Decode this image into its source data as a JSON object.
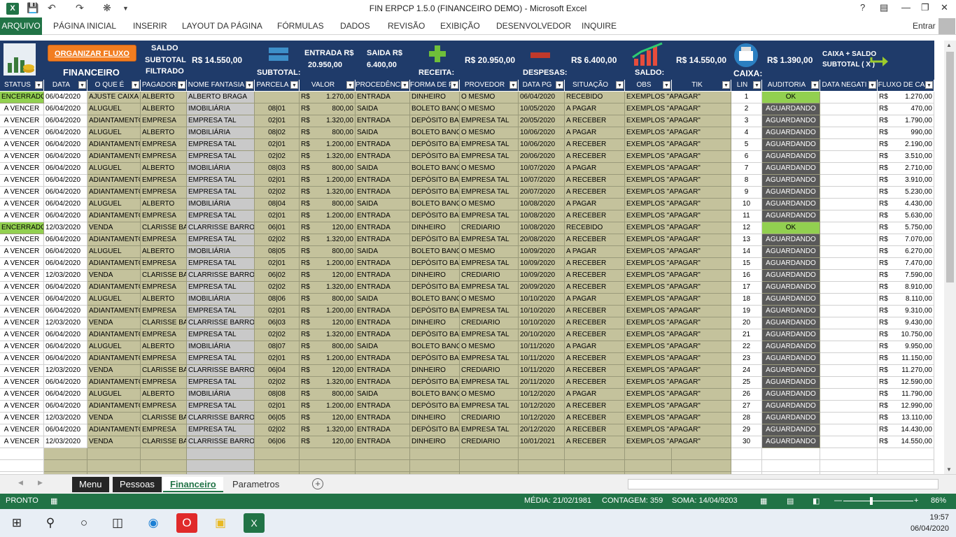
{
  "window": {
    "title": "FIN ERPCP 1.5.0 (FINANCEIRO DEMO) - Microsoft Excel",
    "help": "?",
    "app_icon": "X"
  },
  "ribbon": {
    "file_tab": "ARQUIVO",
    "tabs": [
      "PÁGINA INICIAL",
      "INSERIR",
      "LAYOUT DA PÁGINA",
      "FÓRMULAS",
      "DADOS",
      "REVISÃO",
      "EXIBIÇÃO",
      "DESENVOLVEDOR",
      "INQUIRE"
    ],
    "sign_in": "Entrar"
  },
  "header": {
    "financeiro": "FINANCEIRO",
    "organizar_button": "ORGANIZAR FLUXO",
    "saldo_subtotal_label_1": "SALDO",
    "saldo_subtotal_label_2": "SUBTOTAL",
    "saldo_subtotal_label_3": "FILTRADO",
    "saldo_subtotal_value": "R$ 14.550,00",
    "subtotal_label": "SUBTOTAL:",
    "entrada_label": "ENTRADA R$",
    "entrada_value": "20.950,00",
    "saida_label": "SAIDA R$",
    "saida_value": "6.400,00",
    "receita_label": "RECEITA:",
    "receita_value": "R$ 20.950,00",
    "despesas_label": "DESPESAS:",
    "despesas_value": "R$ 6.400,00",
    "saldo_label": "SALDO:",
    "saldo_value": "R$ 14.550,00",
    "caixa_label": "CAIXA:",
    "caixa_value": "R$ 1.390,00",
    "caixa_saldo_label_1": "CAIXA + SALDO",
    "caixa_saldo_label_2": "SUBTOTAL ( X )"
  },
  "columns": [
    "STATUS",
    "DATA",
    "O QUE É",
    "PAGADOR",
    "NOME FANTASIA",
    "PARCELA",
    "VALOR",
    "PROCEDÊNCI",
    "FORMA DE P",
    "PROVEDOR",
    "DATA PG",
    "SITUAÇÃO",
    "OBS",
    "TIK",
    "LIN",
    "AUDITORIA",
    "DATA NEGATI",
    "FLUXO DE CA"
  ],
  "rows": [
    {
      "status": "ENCERRADO",
      "data": "06/04/2020",
      "oque": "AJUSTE CAIXA",
      "pagador": "ALBERTO",
      "fantasia": "ALBERTO BRAGA",
      "parcela": "",
      "cur": "R$",
      "valor": "1.270,00",
      "proc": "ENTRADA",
      "forma": "DINHEIRO",
      "prov": "O MESMO",
      "datapg": "06/04/2020",
      "sit": "RECEBIDO",
      "obs": "EXEMPLOS \"APAGAR\"",
      "lin": "1",
      "aud": "OK",
      "fcur": "R$",
      "fluxo": "1.270,00"
    },
    {
      "status": "A VENCER",
      "data": "06/04/2020",
      "oque": "ALUGUEL",
      "pagador": "ALBERTO",
      "fantasia": "IMOBILIÁRIA",
      "parcela": "08|01",
      "cur": "R$",
      "valor": "800,00",
      "proc": "SAIDA",
      "forma": "BOLETO BANCÁ",
      "prov": "O MESMO",
      "datapg": "10/05/2020",
      "sit": "A PAGAR",
      "obs": "EXEMPLOS \"APAGAR\"",
      "lin": "2",
      "aud": "AGUARDANDO",
      "fcur": "R$",
      "fluxo": "470,00"
    },
    {
      "status": "A VENCER",
      "data": "06/04/2020",
      "oque": "ADIANTAMENTO",
      "pagador": "EMPRESA",
      "fantasia": "EMPRESA TAL",
      "parcela": "02|01",
      "cur": "R$",
      "valor": "1.320,00",
      "proc": "ENTRADA",
      "forma": "DEPÓSITO BANC",
      "prov": "EMPRESA TAL",
      "datapg": "20/05/2020",
      "sit": "A RECEBER",
      "obs": "EXEMPLOS \"APAGAR\"",
      "lin": "3",
      "aud": "AGUARDANDO",
      "fcur": "R$",
      "fluxo": "1.790,00"
    },
    {
      "status": "A VENCER",
      "data": "06/04/2020",
      "oque": "ALUGUEL",
      "pagador": "ALBERTO",
      "fantasia": "IMOBILIÁRIA",
      "parcela": "08|02",
      "cur": "R$",
      "valor": "800,00",
      "proc": "SAIDA",
      "forma": "BOLETO BANCÁ",
      "prov": "O MESMO",
      "datapg": "10/06/2020",
      "sit": "A PAGAR",
      "obs": "EXEMPLOS \"APAGAR\"",
      "lin": "4",
      "aud": "AGUARDANDO",
      "fcur": "R$",
      "fluxo": "990,00"
    },
    {
      "status": "A VENCER",
      "data": "06/04/2020",
      "oque": "ADIANTAMENTO",
      "pagador": "EMPRESA",
      "fantasia": "EMPRESA TAL",
      "parcela": "02|01",
      "cur": "R$",
      "valor": "1.200,00",
      "proc": "ENTRADA",
      "forma": "DEPÓSITO BANC",
      "prov": "EMPRESA TAL",
      "datapg": "10/06/2020",
      "sit": "A RECEBER",
      "obs": "EXEMPLOS \"APAGAR\"",
      "lin": "5",
      "aud": "AGUARDANDO",
      "fcur": "R$",
      "fluxo": "2.190,00"
    },
    {
      "status": "A VENCER",
      "data": "06/04/2020",
      "oque": "ADIANTAMENTO",
      "pagador": "EMPRESA",
      "fantasia": "EMPRESA TAL",
      "parcela": "02|02",
      "cur": "R$",
      "valor": "1.320,00",
      "proc": "ENTRADA",
      "forma": "DEPÓSITO BANC",
      "prov": "EMPRESA TAL",
      "datapg": "20/06/2020",
      "sit": "A RECEBER",
      "obs": "EXEMPLOS \"APAGAR\"",
      "lin": "6",
      "aud": "AGUARDANDO",
      "fcur": "R$",
      "fluxo": "3.510,00"
    },
    {
      "status": "A VENCER",
      "data": "06/04/2020",
      "oque": "ALUGUEL",
      "pagador": "ALBERTO",
      "fantasia": "IMOBILIÁRIA",
      "parcela": "08|03",
      "cur": "R$",
      "valor": "800,00",
      "proc": "SAIDA",
      "forma": "BOLETO BANCÁ",
      "prov": "O MESMO",
      "datapg": "10/07/2020",
      "sit": "A PAGAR",
      "obs": "EXEMPLOS \"APAGAR\"",
      "lin": "7",
      "aud": "AGUARDANDO",
      "fcur": "R$",
      "fluxo": "2.710,00"
    },
    {
      "status": "A VENCER",
      "data": "06/04/2020",
      "oque": "ADIANTAMENTO",
      "pagador": "EMPRESA",
      "fantasia": "EMPRESA TAL",
      "parcela": "02|01",
      "cur": "R$",
      "valor": "1.200,00",
      "proc": "ENTRADA",
      "forma": "DEPÓSITO BANC",
      "prov": "EMPRESA TAL",
      "datapg": "10/07/2020",
      "sit": "A RECEBER",
      "obs": "EXEMPLOS \"APAGAR\"",
      "lin": "8",
      "aud": "AGUARDANDO",
      "fcur": "R$",
      "fluxo": "3.910,00"
    },
    {
      "status": "A VENCER",
      "data": "06/04/2020",
      "oque": "ADIANTAMENTO",
      "pagador": "EMPRESA",
      "fantasia": "EMPRESA TAL",
      "parcela": "02|02",
      "cur": "R$",
      "valor": "1.320,00",
      "proc": "ENTRADA",
      "forma": "DEPÓSITO BANC",
      "prov": "EMPRESA TAL",
      "datapg": "20/07/2020",
      "sit": "A RECEBER",
      "obs": "EXEMPLOS \"APAGAR\"",
      "lin": "9",
      "aud": "AGUARDANDO",
      "fcur": "R$",
      "fluxo": "5.230,00"
    },
    {
      "status": "A VENCER",
      "data": "06/04/2020",
      "oque": "ALUGUEL",
      "pagador": "ALBERTO",
      "fantasia": "IMOBILIÁRIA",
      "parcela": "08|04",
      "cur": "R$",
      "valor": "800,00",
      "proc": "SAIDA",
      "forma": "BOLETO BANCÁ",
      "prov": "O MESMO",
      "datapg": "10/08/2020",
      "sit": "A PAGAR",
      "obs": "EXEMPLOS \"APAGAR\"",
      "lin": "10",
      "aud": "AGUARDANDO",
      "fcur": "R$",
      "fluxo": "4.430,00"
    },
    {
      "status": "A VENCER",
      "data": "06/04/2020",
      "oque": "ADIANTAMENTO",
      "pagador": "EMPRESA",
      "fantasia": "EMPRESA TAL",
      "parcela": "02|01",
      "cur": "R$",
      "valor": "1.200,00",
      "proc": "ENTRADA",
      "forma": "DEPÓSITO BANC",
      "prov": "EMPRESA TAL",
      "datapg": "10/08/2020",
      "sit": "A RECEBER",
      "obs": "EXEMPLOS \"APAGAR\"",
      "lin": "11",
      "aud": "AGUARDANDO",
      "fcur": "R$",
      "fluxo": "5.630,00"
    },
    {
      "status": "ENCERRADO",
      "data": "12/03/2020",
      "oque": "VENDA",
      "pagador": "CLARISSE BARR",
      "fantasia": "CLARRISSE BARROS SI",
      "parcela": "06|01",
      "cur": "R$",
      "valor": "120,00",
      "proc": "ENTRADA",
      "forma": "DINHEIRO",
      "prov": "CREDIARIO",
      "datapg": "10/08/2020",
      "sit": "RECEBIDO",
      "obs": "EXEMPLOS \"APAGAR\"",
      "lin": "12",
      "aud": "OK",
      "fcur": "R$",
      "fluxo": "5.750,00"
    },
    {
      "status": "A VENCER",
      "data": "06/04/2020",
      "oque": "ADIANTAMENTO",
      "pagador": "EMPRESA",
      "fantasia": "EMPRESA TAL",
      "parcela": "02|02",
      "cur": "R$",
      "valor": "1.320,00",
      "proc": "ENTRADA",
      "forma": "DEPÓSITO BANC",
      "prov": "EMPRESA TAL",
      "datapg": "20/08/2020",
      "sit": "A RECEBER",
      "obs": "EXEMPLOS \"APAGAR\"",
      "lin": "13",
      "aud": "AGUARDANDO",
      "fcur": "R$",
      "fluxo": "7.070,00"
    },
    {
      "status": "A VENCER",
      "data": "06/04/2020",
      "oque": "ALUGUEL",
      "pagador": "ALBERTO",
      "fantasia": "IMOBILIÁRIA",
      "parcela": "08|05",
      "cur": "R$",
      "valor": "800,00",
      "proc": "SAIDA",
      "forma": "BOLETO BANCÁ",
      "prov": "O MESMO",
      "datapg": "10/09/2020",
      "sit": "A PAGAR",
      "obs": "EXEMPLOS \"APAGAR\"",
      "lin": "14",
      "aud": "AGUARDANDO",
      "fcur": "R$",
      "fluxo": "6.270,00"
    },
    {
      "status": "A VENCER",
      "data": "06/04/2020",
      "oque": "ADIANTAMENTO",
      "pagador": "EMPRESA",
      "fantasia": "EMPRESA TAL",
      "parcela": "02|01",
      "cur": "R$",
      "valor": "1.200,00",
      "proc": "ENTRADA",
      "forma": "DEPÓSITO BANC",
      "prov": "EMPRESA TAL",
      "datapg": "10/09/2020",
      "sit": "A RECEBER",
      "obs": "EXEMPLOS \"APAGAR\"",
      "lin": "15",
      "aud": "AGUARDANDO",
      "fcur": "R$",
      "fluxo": "7.470,00"
    },
    {
      "status": "A VENCER",
      "data": "12/03/2020",
      "oque": "VENDA",
      "pagador": "CLARISSE BARR",
      "fantasia": "CLARRISSE BARROS SI",
      "parcela": "06|02",
      "cur": "R$",
      "valor": "120,00",
      "proc": "ENTRADA",
      "forma": "DINHEIRO",
      "prov": "CREDIARIO",
      "datapg": "10/09/2020",
      "sit": "A RECEBER",
      "obs": "EXEMPLOS \"APAGAR\"",
      "lin": "16",
      "aud": "AGUARDANDO",
      "fcur": "R$",
      "fluxo": "7.590,00"
    },
    {
      "status": "A VENCER",
      "data": "06/04/2020",
      "oque": "ADIANTAMENTO",
      "pagador": "EMPRESA",
      "fantasia": "EMPRESA TAL",
      "parcela": "02|02",
      "cur": "R$",
      "valor": "1.320,00",
      "proc": "ENTRADA",
      "forma": "DEPÓSITO BANC",
      "prov": "EMPRESA TAL",
      "datapg": "20/09/2020",
      "sit": "A RECEBER",
      "obs": "EXEMPLOS \"APAGAR\"",
      "lin": "17",
      "aud": "AGUARDANDO",
      "fcur": "R$",
      "fluxo": "8.910,00"
    },
    {
      "status": "A VENCER",
      "data": "06/04/2020",
      "oque": "ALUGUEL",
      "pagador": "ALBERTO",
      "fantasia": "IMOBILIÁRIA",
      "parcela": "08|06",
      "cur": "R$",
      "valor": "800,00",
      "proc": "SAIDA",
      "forma": "BOLETO BANCÁ",
      "prov": "O MESMO",
      "datapg": "10/10/2020",
      "sit": "A PAGAR",
      "obs": "EXEMPLOS \"APAGAR\"",
      "lin": "18",
      "aud": "AGUARDANDO",
      "fcur": "R$",
      "fluxo": "8.110,00"
    },
    {
      "status": "A VENCER",
      "data": "06/04/2020",
      "oque": "ADIANTAMENTO",
      "pagador": "EMPRESA",
      "fantasia": "EMPRESA TAL",
      "parcela": "02|01",
      "cur": "R$",
      "valor": "1.200,00",
      "proc": "ENTRADA",
      "forma": "DEPÓSITO BANC",
      "prov": "EMPRESA TAL",
      "datapg": "10/10/2020",
      "sit": "A RECEBER",
      "obs": "EXEMPLOS \"APAGAR\"",
      "lin": "19",
      "aud": "AGUARDANDO",
      "fcur": "R$",
      "fluxo": "9.310,00"
    },
    {
      "status": "A VENCER",
      "data": "12/03/2020",
      "oque": "VENDA",
      "pagador": "CLARISSE BARR",
      "fantasia": "CLARRISSE BARROS SI",
      "parcela": "06|03",
      "cur": "R$",
      "valor": "120,00",
      "proc": "ENTRADA",
      "forma": "DINHEIRO",
      "prov": "CREDIARIO",
      "datapg": "10/10/2020",
      "sit": "A RECEBER",
      "obs": "EXEMPLOS \"APAGAR\"",
      "lin": "20",
      "aud": "AGUARDANDO",
      "fcur": "R$",
      "fluxo": "9.430,00"
    },
    {
      "status": "A VENCER",
      "data": "06/04/2020",
      "oque": "ADIANTAMENTO",
      "pagador": "EMPRESA",
      "fantasia": "EMPRESA TAL",
      "parcela": "02|02",
      "cur": "R$",
      "valor": "1.320,00",
      "proc": "ENTRADA",
      "forma": "DEPÓSITO BANC",
      "prov": "EMPRESA TAL",
      "datapg": "20/10/2020",
      "sit": "A RECEBER",
      "obs": "EXEMPLOS \"APAGAR\"",
      "lin": "21",
      "aud": "AGUARDANDO",
      "fcur": "R$",
      "fluxo": "10.750,00"
    },
    {
      "status": "A VENCER",
      "data": "06/04/2020",
      "oque": "ALUGUEL",
      "pagador": "ALBERTO",
      "fantasia": "IMOBILIÁRIA",
      "parcela": "08|07",
      "cur": "R$",
      "valor": "800,00",
      "proc": "SAIDA",
      "forma": "BOLETO BANCÁ",
      "prov": "O MESMO",
      "datapg": "10/11/2020",
      "sit": "A PAGAR",
      "obs": "EXEMPLOS \"APAGAR\"",
      "lin": "22",
      "aud": "AGUARDANDO",
      "fcur": "R$",
      "fluxo": "9.950,00"
    },
    {
      "status": "A VENCER",
      "data": "06/04/2020",
      "oque": "ADIANTAMENTO",
      "pagador": "EMPRESA",
      "fantasia": "EMPRESA TAL",
      "parcela": "02|01",
      "cur": "R$",
      "valor": "1.200,00",
      "proc": "ENTRADA",
      "forma": "DEPÓSITO BANC",
      "prov": "EMPRESA TAL",
      "datapg": "10/11/2020",
      "sit": "A RECEBER",
      "obs": "EXEMPLOS \"APAGAR\"",
      "lin": "23",
      "aud": "AGUARDANDO",
      "fcur": "R$",
      "fluxo": "11.150,00"
    },
    {
      "status": "A VENCER",
      "data": "12/03/2020",
      "oque": "VENDA",
      "pagador": "CLARISSE BARR",
      "fantasia": "CLARRISSE BARROS SI",
      "parcela": "06|04",
      "cur": "R$",
      "valor": "120,00",
      "proc": "ENTRADA",
      "forma": "DINHEIRO",
      "prov": "CREDIARIO",
      "datapg": "10/11/2020",
      "sit": "A RECEBER",
      "obs": "EXEMPLOS \"APAGAR\"",
      "lin": "24",
      "aud": "AGUARDANDO",
      "fcur": "R$",
      "fluxo": "11.270,00"
    },
    {
      "status": "A VENCER",
      "data": "06/04/2020",
      "oque": "ADIANTAMENTO",
      "pagador": "EMPRESA",
      "fantasia": "EMPRESA TAL",
      "parcela": "02|02",
      "cur": "R$",
      "valor": "1.320,00",
      "proc": "ENTRADA",
      "forma": "DEPÓSITO BANC",
      "prov": "EMPRESA TAL",
      "datapg": "20/11/2020",
      "sit": "A RECEBER",
      "obs": "EXEMPLOS \"APAGAR\"",
      "lin": "25",
      "aud": "AGUARDANDO",
      "fcur": "R$",
      "fluxo": "12.590,00"
    },
    {
      "status": "A VENCER",
      "data": "06/04/2020",
      "oque": "ALUGUEL",
      "pagador": "ALBERTO",
      "fantasia": "IMOBILIÁRIA",
      "parcela": "08|08",
      "cur": "R$",
      "valor": "800,00",
      "proc": "SAIDA",
      "forma": "BOLETO BANCÁ",
      "prov": "O MESMO",
      "datapg": "10/12/2020",
      "sit": "A PAGAR",
      "obs": "EXEMPLOS \"APAGAR\"",
      "lin": "26",
      "aud": "AGUARDANDO",
      "fcur": "R$",
      "fluxo": "11.790,00"
    },
    {
      "status": "A VENCER",
      "data": "06/04/2020",
      "oque": "ADIANTAMENTO",
      "pagador": "EMPRESA",
      "fantasia": "EMPRESA TAL",
      "parcela": "02|01",
      "cur": "R$",
      "valor": "1.200,00",
      "proc": "ENTRADA",
      "forma": "DEPÓSITO BANC",
      "prov": "EMPRESA TAL",
      "datapg": "10/12/2020",
      "sit": "A RECEBER",
      "obs": "EXEMPLOS \"APAGAR\"",
      "lin": "27",
      "aud": "AGUARDANDO",
      "fcur": "R$",
      "fluxo": "12.990,00"
    },
    {
      "status": "A VENCER",
      "data": "12/03/2020",
      "oque": "VENDA",
      "pagador": "CLARISSE BARR",
      "fantasia": "CLARRISSE BARROS SI",
      "parcela": "06|05",
      "cur": "R$",
      "valor": "120,00",
      "proc": "ENTRADA",
      "forma": "DINHEIRO",
      "prov": "CREDIARIO",
      "datapg": "10/12/2020",
      "sit": "A RECEBER",
      "obs": "EXEMPLOS \"APAGAR\"",
      "lin": "28",
      "aud": "AGUARDANDO",
      "fcur": "R$",
      "fluxo": "13.110,00"
    },
    {
      "status": "A VENCER",
      "data": "06/04/2020",
      "oque": "ADIANTAMENTO",
      "pagador": "EMPRESA",
      "fantasia": "EMPRESA TAL",
      "parcela": "02|02",
      "cur": "R$",
      "valor": "1.320,00",
      "proc": "ENTRADA",
      "forma": "DEPÓSITO BANC",
      "prov": "EMPRESA TAL",
      "datapg": "20/12/2020",
      "sit": "A RECEBER",
      "obs": "EXEMPLOS \"APAGAR\"",
      "lin": "29",
      "aud": "AGUARDANDO",
      "fcur": "R$",
      "fluxo": "14.430,00"
    },
    {
      "status": "A VENCER",
      "data": "12/03/2020",
      "oque": "VENDA",
      "pagador": "CLARISSE BARR",
      "fantasia": "CLARRISSE BARROS SI",
      "parcela": "06|06",
      "cur": "R$",
      "valor": "120,00",
      "proc": "ENTRADA",
      "forma": "DINHEIRO",
      "prov": "CREDIARIO",
      "datapg": "10/01/2021",
      "sit": "A RECEBER",
      "obs": "EXEMPLOS \"APAGAR\"",
      "lin": "30",
      "aud": "AGUARDANDO",
      "fcur": "R$",
      "fluxo": "14.550,00"
    }
  ],
  "sheet_tabs": [
    "Menu",
    "Pessoas",
    "Financeiro",
    "Parametros"
  ],
  "statusbar": {
    "ready": "PRONTO",
    "media": "MÉDIA: 21/02/1981",
    "contagem": "CONTAGEM: 359",
    "soma": "SOMA: 14/04/9203",
    "zoom": "86%"
  },
  "taskbar": {
    "time": "19:57",
    "date": "06/04/2020"
  },
  "colors": {
    "excel_green": "#217346",
    "header_navy": "#1f3b6a",
    "row_tan": "#c4c29c",
    "status_green": "#92d050",
    "audit_grey": "#595959",
    "orange": "#f27d20"
  }
}
